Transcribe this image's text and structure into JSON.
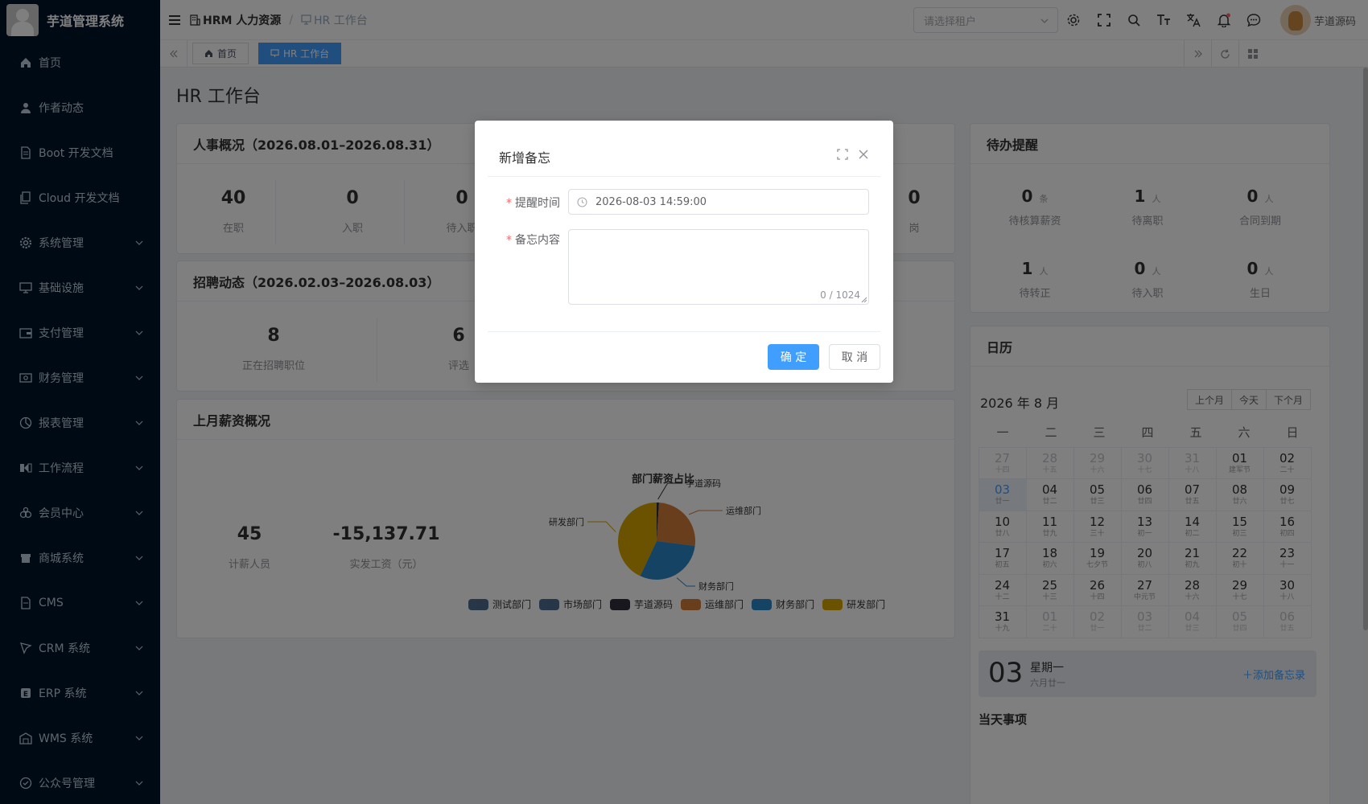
{
  "app": {
    "title": "芋道管理系统"
  },
  "sidebar": {
    "items": [
      {
        "label": "首页",
        "icon": "home-icon",
        "expandable": false
      },
      {
        "label": "作者动态",
        "icon": "user-icon",
        "expandable": false
      },
      {
        "label": "Boot 开发文档",
        "icon": "document-icon",
        "expandable": false
      },
      {
        "label": "Cloud 开发文档",
        "icon": "document-copy-icon",
        "expandable": false
      },
      {
        "label": "系统管理",
        "icon": "gear-icon",
        "expandable": true
      },
      {
        "label": "基础设施",
        "icon": "monitor-icon",
        "expandable": true
      },
      {
        "label": "支付管理",
        "icon": "wallet-icon",
        "expandable": true
      },
      {
        "label": "财务管理",
        "icon": "money-icon",
        "expandable": true
      },
      {
        "label": "报表管理",
        "icon": "pie-chart-icon",
        "expandable": true
      },
      {
        "label": "工作流程",
        "icon": "workflow-icon",
        "expandable": true
      },
      {
        "label": "会员中心",
        "icon": "members-icon",
        "expandable": true
      },
      {
        "label": "商城系统",
        "icon": "shop-icon",
        "expandable": true
      },
      {
        "label": "CMS",
        "icon": "cms-icon",
        "expandable": true
      },
      {
        "label": "CRM 系统",
        "icon": "crm-icon",
        "expandable": true
      },
      {
        "label": "ERP 系统",
        "icon": "erp-icon",
        "expandable": true
      },
      {
        "label": "WMS 系统",
        "icon": "warehouse-icon",
        "expandable": true
      },
      {
        "label": "公众号管理",
        "icon": "wechat-icon",
        "expandable": true
      }
    ]
  },
  "header": {
    "breadcrumb": [
      "HRM 人力资源",
      "HR 工作台"
    ],
    "tenant_placeholder": "请选择租户",
    "username": "芋道源码"
  },
  "tags": {
    "home": "首页",
    "active": "HR 工作台"
  },
  "page": {
    "title": "HR 工作台"
  },
  "personnel": {
    "title": "人事概况（2026.08.01–2026.08.31）",
    "stats": [
      {
        "value": "40",
        "label": "在职"
      },
      {
        "value": "0",
        "label": "入职"
      },
      {
        "value": "0",
        "label": "待入职"
      }
    ],
    "partial_value": "0",
    "partial_label": "岗"
  },
  "recruit": {
    "title": "招聘动态（2026.02.03–2026.08.03）",
    "stats": [
      {
        "value": "8",
        "label": "正在招聘职位"
      },
      {
        "value": "6",
        "label": "评选"
      }
    ]
  },
  "salary": {
    "title": "上月薪资概况",
    "stats": [
      {
        "value": "45",
        "label": "计薪人员"
      },
      {
        "value": "-15,137.71",
        "label": "实发工资（元）"
      }
    ]
  },
  "chart_data": {
    "type": "pie",
    "title": "部门薪资占比",
    "categories": [
      "测试部门",
      "市场部门",
      "芋道源码",
      "运维部门",
      "财务部门",
      "研发部门"
    ],
    "values": [
      0,
      0,
      1,
      26,
      30,
      43
    ],
    "colors": [
      "#4f6f8f",
      "#4e6f93",
      "#2f2f3a",
      "#d07d3a",
      "#2a87c9",
      "#d6a400"
    ],
    "labels_visible": [
      "芋道源码",
      "运维部门",
      "财务部门",
      "研发部门"
    ]
  },
  "todo": {
    "title": "待办提醒",
    "items": [
      {
        "value": "0",
        "unit": "条",
        "label": "待核算薪资"
      },
      {
        "value": "1",
        "unit": "人",
        "label": "待离职"
      },
      {
        "value": "0",
        "unit": "人",
        "label": "合同到期"
      },
      {
        "value": "1",
        "unit": "人",
        "label": "待转正"
      },
      {
        "value": "0",
        "unit": "人",
        "label": "待入职"
      },
      {
        "value": "0",
        "unit": "人",
        "label": "生日"
      }
    ]
  },
  "calendar": {
    "title": "日历",
    "month_label": "2026 年 8 月",
    "buttons": [
      "上个月",
      "今天",
      "下个月"
    ],
    "weekdays": [
      "一",
      "二",
      "三",
      "四",
      "五",
      "六",
      "日"
    ],
    "weeks": [
      [
        [
          "27",
          "十四",
          1
        ],
        [
          "28",
          "十五",
          1
        ],
        [
          "29",
          "十六",
          1
        ],
        [
          "30",
          "十七",
          1
        ],
        [
          "31",
          "十八",
          1
        ],
        [
          "01",
          "建军节",
          0
        ],
        [
          "02",
          "二十",
          0
        ]
      ],
      [
        [
          "03",
          "廿一",
          2
        ],
        [
          "04",
          "廿二",
          0
        ],
        [
          "05",
          "廿三",
          0
        ],
        [
          "06",
          "廿四",
          0
        ],
        [
          "07",
          "廿五",
          0
        ],
        [
          "08",
          "廿六",
          0
        ],
        [
          "09",
          "廿七",
          0
        ]
      ],
      [
        [
          "10",
          "廿八",
          0
        ],
        [
          "11",
          "廿九",
          0
        ],
        [
          "12",
          "三十",
          0
        ],
        [
          "13",
          "初一",
          0
        ],
        [
          "14",
          "初二",
          0
        ],
        [
          "15",
          "初三",
          0
        ],
        [
          "16",
          "初四",
          0
        ]
      ],
      [
        [
          "17",
          "初五",
          0
        ],
        [
          "18",
          "初六",
          0
        ],
        [
          "19",
          "七夕节",
          0
        ],
        [
          "20",
          "初八",
          0
        ],
        [
          "21",
          "初九",
          0
        ],
        [
          "22",
          "初十",
          0
        ],
        [
          "23",
          "十一",
          0
        ]
      ],
      [
        [
          "24",
          "十二",
          0
        ],
        [
          "25",
          "十三",
          0
        ],
        [
          "26",
          "十四",
          0
        ],
        [
          "27",
          "中元节",
          0
        ],
        [
          "28",
          "十六",
          0
        ],
        [
          "29",
          "十七",
          0
        ],
        [
          "30",
          "十八",
          0
        ]
      ],
      [
        [
          "31",
          "十九",
          0
        ],
        [
          "01",
          "二十",
          1
        ],
        [
          "02",
          "廿一",
          1
        ],
        [
          "03",
          "廿二",
          1
        ],
        [
          "04",
          "廿三",
          1
        ],
        [
          "05",
          "廿四",
          1
        ],
        [
          "06",
          "廿五",
          1
        ]
      ]
    ],
    "selected_day": "03",
    "selected_weekday": "星期一",
    "selected_lunar": "六月廿一",
    "add_memo": "添加备忘录",
    "today_items_title": "当天事项"
  },
  "dialog": {
    "title": "新增备忘",
    "time_label": "提醒时间",
    "time_value": "2026-08-03 14:59:00",
    "content_label": "备忘内容",
    "content_count": "0 / 1024",
    "ok": "确 定",
    "cancel": "取 消"
  }
}
